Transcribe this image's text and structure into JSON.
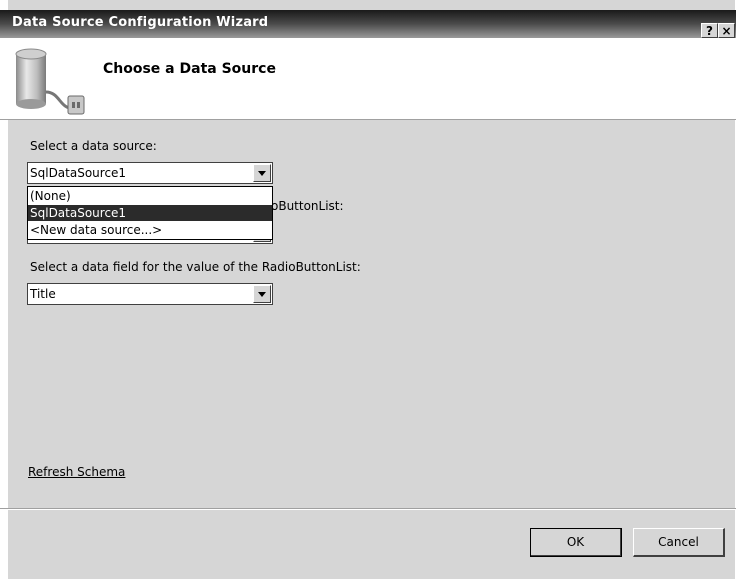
{
  "window": {
    "title": "Data Source Configuration Wizard",
    "help_button": "?",
    "close_button": "×"
  },
  "header": {
    "title": "Choose a Data Source",
    "icon": "database-plug-icon"
  },
  "data_source": {
    "label": "Select a data source:",
    "selected_value": "SqlDataSource1",
    "options": [
      "(None)",
      "SqlDataSource1",
      "<New data source...>"
    ],
    "highlighted_option": "SqlDataSource1"
  },
  "display_field": {
    "label_visible_part": "oButtonList:"
  },
  "value_field": {
    "label": "Select a data field for the value of the RadioButtonList:",
    "selected_value": "Title"
  },
  "links": {
    "refresh_schema": "Refresh Schema"
  },
  "buttons": {
    "ok": "OK",
    "cancel": "Cancel"
  },
  "colors": {
    "dialog_bg": "#d6d6d6",
    "header_bg": "#ffffff",
    "selection_bg": "#2b2b2b"
  }
}
